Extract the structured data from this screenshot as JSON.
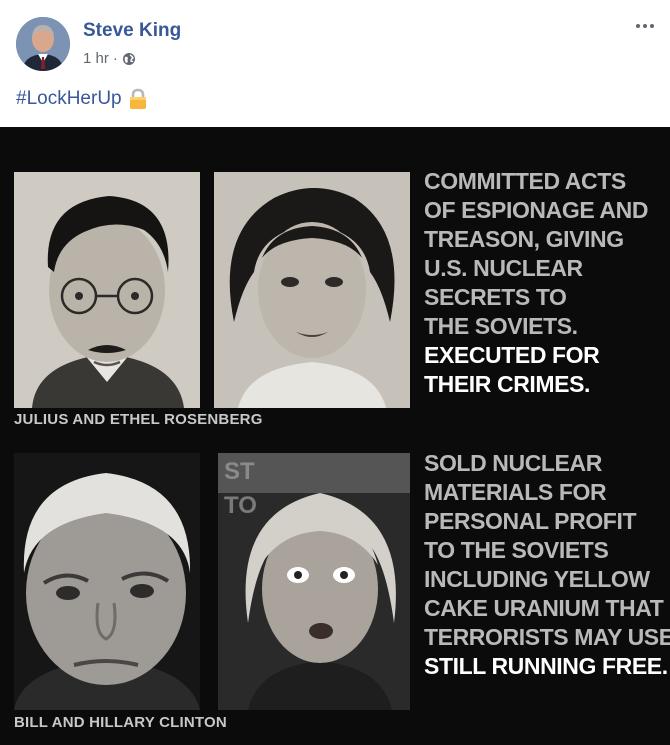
{
  "post": {
    "author": "Steve King",
    "timestamp": "1 hr",
    "separator": "·",
    "privacy_icon": "globe-icon",
    "more_icon": "more-horizontal-icon",
    "text": "#LockHerUp",
    "text_emoji": "lock-icon"
  },
  "meme": {
    "top": {
      "caption": "JULIUS AND ETHEL ROSENBERG",
      "lines": [
        "COMMITTED ACTS",
        "OF ESPIONAGE AND",
        "TREASON, GIVING",
        "U.S. NUCLEAR",
        "SECRETS TO",
        "THE SOVIETS."
      ],
      "highlight_lines": [
        "EXECUTED FOR",
        "THEIR CRIMES."
      ]
    },
    "bottom": {
      "caption": "BILL AND HILLARY CLINTON",
      "background_sign_text": "ST",
      "background_sign_text_2": "TO",
      "lines": [
        "SOLD NUCLEAR",
        "MATERIALS FOR",
        "PERSONAL PROFIT",
        "TO THE SOVIETS",
        "INCLUDING YELLOW",
        "CAKE URANIUM THAT",
        "TERRORISTS MAY USE."
      ],
      "highlight_lines": [
        "STILL RUNNING FREE."
      ]
    }
  },
  "colors": {
    "name_blue": "#385898",
    "meme_bg": "#0b0b0b",
    "statement_gray": "#b9b9b9",
    "statement_white": "#ffffff"
  }
}
